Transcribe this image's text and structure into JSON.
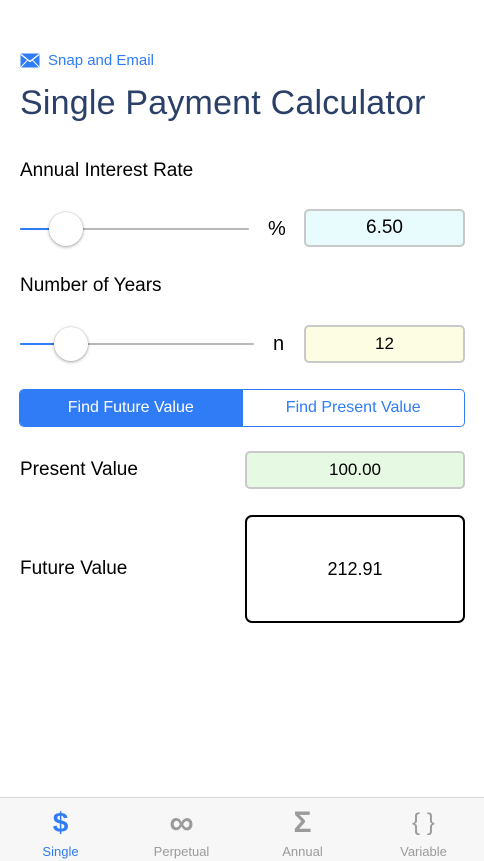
{
  "header": {
    "snap_label": "Snap and Email",
    "title": "Single Payment Calculator"
  },
  "interest": {
    "label": "Annual Interest Rate",
    "unit": "%",
    "value": "6.50",
    "slider_fraction": 0.15,
    "field_color": "#e8fbfd"
  },
  "years": {
    "label": "Number of Years",
    "unit": "n",
    "value": "12",
    "slider_fraction": 0.17,
    "field_color": "#fdfde3"
  },
  "mode": {
    "future_label": "Find Future Value",
    "present_label": "Find Present Value",
    "selected": "future"
  },
  "present": {
    "label": "Present Value",
    "value": "100.00",
    "field_color": "#e6f9e3"
  },
  "future": {
    "label": "Future Value",
    "value": "212.91"
  },
  "tabs": [
    {
      "icon": "$",
      "label": "Single",
      "active": true
    },
    {
      "icon": "∞",
      "label": "Perpetual",
      "active": false
    },
    {
      "icon": "Σ",
      "label": "Annual",
      "active": false
    },
    {
      "icon": "{ }",
      "label": "Variable",
      "active": false
    }
  ],
  "colors": {
    "accent": "#2f7cf6",
    "title": "#2b4069",
    "inactive": "#9b9b9b"
  }
}
